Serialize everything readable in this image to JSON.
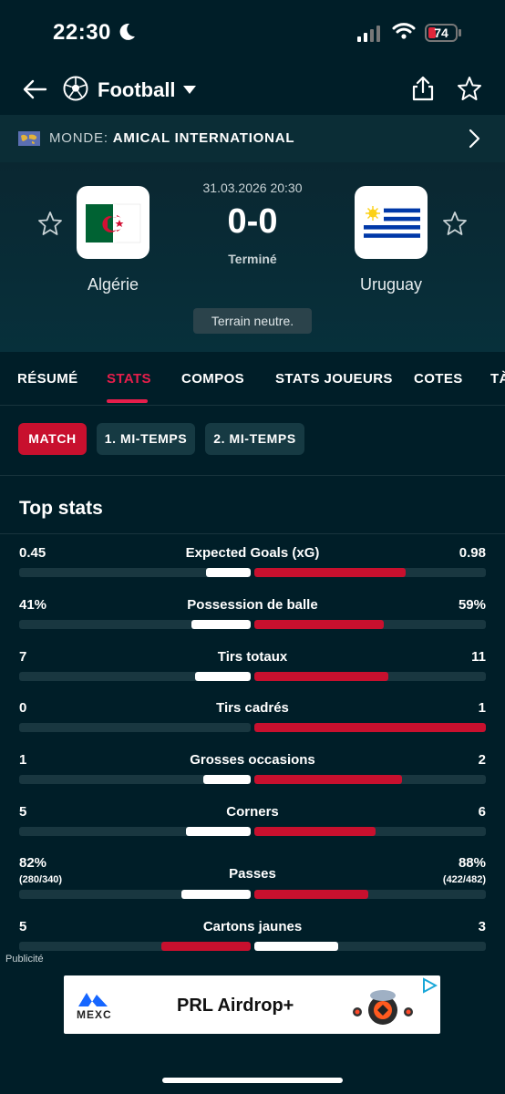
{
  "status_bar": {
    "time": "22:30",
    "battery": "74"
  },
  "header": {
    "sport": "Football"
  },
  "competition": {
    "prefix": "MONDE:",
    "name": "AMICAL INTERNATIONAL"
  },
  "match": {
    "date": "31.03.2026 20:30",
    "score": "0-0",
    "status": "Terminé",
    "home": {
      "name": "Algérie"
    },
    "away": {
      "name": "Uruguay"
    },
    "note": "Terrain neutre."
  },
  "tabs": [
    {
      "label": "RÉSUMÉ"
    },
    {
      "label": "STATS"
    },
    {
      "label": "COMPOS"
    },
    {
      "label": "STATS JOUEURS"
    },
    {
      "label": "COTES"
    },
    {
      "label": "TÀ"
    }
  ],
  "periods": [
    {
      "label": "MATCH"
    },
    {
      "label": "1. MI-TEMPS"
    },
    {
      "label": "2. MI-TEMPS"
    }
  ],
  "section_title": "Top stats",
  "stats": [
    {
      "label": "Expected Goals (xG)",
      "home": "0.45",
      "away": "0.98",
      "home_share": 0.31,
      "away_share": 0.69,
      "highlight": "away"
    },
    {
      "label": "Possession de balle",
      "home": "41%",
      "away": "59%",
      "home_share": 0.41,
      "away_share": 0.59,
      "highlight": "away"
    },
    {
      "label": "Tirs totaux",
      "home": "7",
      "away": "11",
      "home_share": 0.39,
      "away_share": 0.61,
      "highlight": "away"
    },
    {
      "label": "Tirs cadrés",
      "home": "0",
      "away": "1",
      "home_share": 0.0,
      "away_share": 1.0,
      "highlight": "away"
    },
    {
      "label": "Grosses occasions",
      "home": "1",
      "away": "2",
      "home_share": 0.33,
      "away_share": 0.67,
      "highlight": "away"
    },
    {
      "label": "Corners",
      "home": "5",
      "away": "6",
      "home_share": 0.45,
      "away_share": 0.55,
      "highlight": "away"
    },
    {
      "label": "Passes",
      "home": "82%",
      "away": "88%",
      "home_sub": "(280/340)",
      "away_sub": "(422/482)",
      "home_share": 0.48,
      "away_share": 0.52,
      "highlight": "away"
    },
    {
      "label": "Cartons jaunes",
      "home": "5",
      "away": "3",
      "home_share": 0.62,
      "away_share": 0.38,
      "highlight": "home"
    }
  ],
  "ad": {
    "label": "Publicité",
    "brand": "MEXC",
    "title": "PRL Airdrop+"
  },
  "colors": {
    "accent": "#e61e4b",
    "highlight_bar": "#c8102e",
    "neutral_bar": "#ffffff",
    "background": "#001e28"
  }
}
